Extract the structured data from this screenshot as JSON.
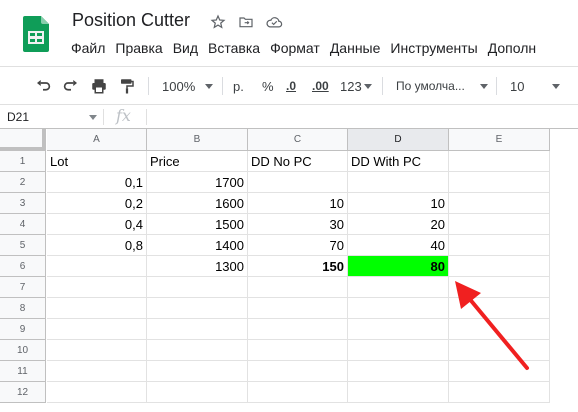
{
  "app": {
    "title": "Position Cutter"
  },
  "menu": [
    "Файл",
    "Правка",
    "Вид",
    "Вставка",
    "Формат",
    "Данные",
    "Инструменты",
    "Дополн"
  ],
  "toolbar": {
    "zoom": "100%",
    "currency": "р.",
    "percent": "%",
    "dec_decrease": ".0",
    "dec_increase": ".00",
    "more_formats": "123",
    "font": "По умолча...",
    "font_size": "10"
  },
  "formula_bar": {
    "name_box": "D21",
    "fx": "fx"
  },
  "columns": [
    "A",
    "B",
    "C",
    "D",
    "E"
  ],
  "rows": [
    "1",
    "2",
    "3",
    "4",
    "5",
    "6",
    "7",
    "8",
    "9",
    "10",
    "11",
    "12"
  ],
  "cells": {
    "r1": [
      "Lot",
      "Price",
      "DD No PC",
      "DD With PC",
      ""
    ],
    "r2": [
      "0,1",
      "1700",
      "",
      "",
      ""
    ],
    "r3": [
      "0,2",
      "1600",
      "10",
      "10",
      ""
    ],
    "r4": [
      "0,4",
      "1500",
      "30",
      "20",
      ""
    ],
    "r5": [
      "0,8",
      "1400",
      "70",
      "40",
      ""
    ],
    "r6": [
      "",
      "1300",
      "150",
      "80",
      ""
    ]
  },
  "colors": {
    "highlight": "#00ff00",
    "arrow": "#f02020",
    "sheets_green": "#0f9d58"
  }
}
